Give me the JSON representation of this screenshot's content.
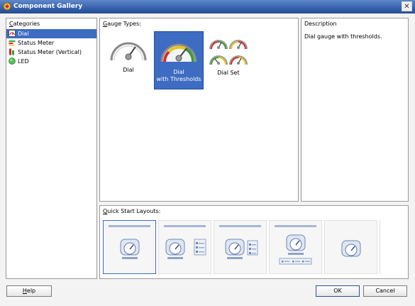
{
  "window": {
    "title": "Component Gallery",
    "close_glyph": "✕"
  },
  "categories": {
    "label_first": "C",
    "label_rest": "ategories",
    "items": [
      {
        "label": "Dial",
        "icon": "dial-icon",
        "selected": true
      },
      {
        "label": "Status Meter",
        "icon": "status-meter-icon",
        "selected": false
      },
      {
        "label": "Status Meter (Vertical)",
        "icon": "status-meter-vertical-icon",
        "selected": false
      },
      {
        "label": "LED",
        "icon": "led-icon",
        "selected": false
      }
    ]
  },
  "gauge_types": {
    "label_first": "G",
    "label_rest": "auge Types:",
    "items": [
      {
        "label_line1": "Dial",
        "label_line2": "",
        "selected": false
      },
      {
        "label_line1": "Dial",
        "label_line2": "with Thresholds",
        "selected": true
      },
      {
        "label_line1": "Dial Set",
        "label_line2": "",
        "selected": false
      }
    ]
  },
  "description": {
    "label": "Description",
    "text": "Dial gauge with thresholds."
  },
  "quick_start": {
    "label_first": "Q",
    "label_rest": "uick Start Layouts:"
  },
  "buttons": {
    "help_first": "H",
    "help_rest": "elp",
    "ok": "OK",
    "cancel": "Cancel"
  },
  "colors": {
    "titlebar": "#2f5aa6",
    "selection": "#3d6cc2",
    "threshold_red": "#d9262b",
    "threshold_yellow": "#e8c41c",
    "threshold_green": "#3a9b3a"
  }
}
